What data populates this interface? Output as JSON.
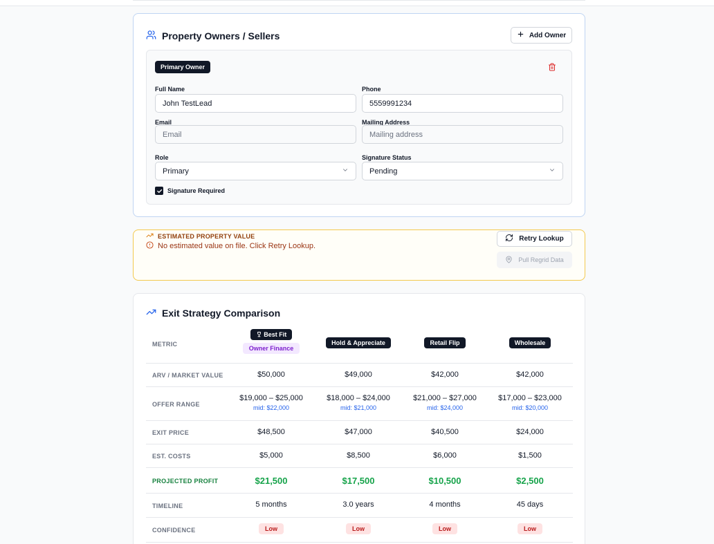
{
  "owners": {
    "title": "Property Owners / Sellers",
    "add_owner_label": "Add Owner",
    "owner": {
      "badge": "Primary Owner",
      "full_name_label": "Full Name",
      "full_name_value": "John TestLead",
      "phone_label": "Phone",
      "phone_value": "5559991234",
      "email_label": "Email",
      "email_placeholder": "Email",
      "mailing_label": "Mailing Address",
      "mailing_placeholder": "Mailing address",
      "role_label": "Role",
      "role_value": "Primary",
      "sig_status_label": "Signature Status",
      "sig_status_value": "Pending",
      "sig_required_label": "Signature Required",
      "sig_required_checked": true
    }
  },
  "estimated_value": {
    "title": "ESTIMATED PROPERTY VALUE",
    "message": "No estimated value on file. Click Retry Lookup.",
    "retry_label": "Retry Lookup",
    "regrid_label": "Pull Regrid Data"
  },
  "exit": {
    "title": "Exit Strategy Comparison",
    "metric_header": "METRIC",
    "best_fit_label": "Best Fit",
    "strategies": [
      "Owner Finance",
      "Hold & Appreciate",
      "Retail Flip",
      "Wholesale"
    ],
    "rows": {
      "arv": {
        "label": "ARV / MARKET VALUE",
        "values": [
          "$50,000",
          "$49,000",
          "$42,000",
          "$42,000"
        ]
      },
      "offer": {
        "label": "OFFER RANGE",
        "values": [
          "$19,000 – $25,000",
          "$18,000 – $24,000",
          "$21,000 – $27,000",
          "$17,000 – $23,000"
        ],
        "mids": [
          "mid: $22,000",
          "mid: $21,000",
          "mid: $24,000",
          "mid: $20,000"
        ]
      },
      "exit_price": {
        "label": "EXIT PRICE",
        "values": [
          "$48,500",
          "$47,000",
          "$40,500",
          "$24,000"
        ]
      },
      "costs": {
        "label": "EST. COSTS",
        "values": [
          "$5,000",
          "$8,500",
          "$6,000",
          "$1,500"
        ]
      },
      "profit": {
        "label": "PROJECTED PROFIT",
        "values": [
          "$21,500",
          "$17,500",
          "$10,500",
          "$2,500"
        ]
      },
      "timeline": {
        "label": "TIMELINE",
        "values": [
          "5 months",
          "3.0 years",
          "4 months",
          "45 days"
        ]
      },
      "confidence": {
        "label": "CONFIDENCE",
        "values": [
          "Low",
          "Low",
          "Low",
          "Low"
        ]
      }
    }
  },
  "colors": {
    "accent_blue": "#2563eb",
    "warning_border": "#f3c94d",
    "profit_green": "#16a34a",
    "low_badge_bg": "#fee2e2"
  }
}
